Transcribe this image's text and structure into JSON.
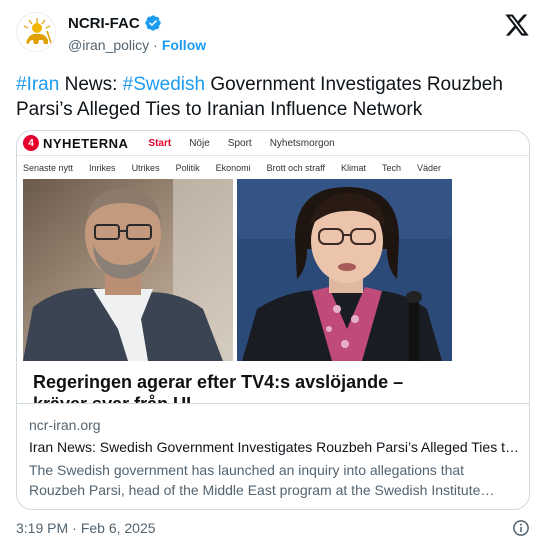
{
  "author": {
    "name": "NCRI-FAC",
    "handle": "@iran_policy",
    "separator": "·",
    "follow_label": "Follow",
    "avatar_icon": "lion-and-sun-emblem-icon",
    "verified_icon": "verified-badge-icon"
  },
  "platform_icon": "x-logo-icon",
  "tweet": {
    "hashtag1": "#Iran",
    "text1": " News: ",
    "hashtag2": "#Swedish",
    "text2": " Government Investigates Rouzbeh Parsi’s Alleged Ties to Iranian Influence Network"
  },
  "card_image": {
    "site_logo": "4",
    "site_name": "NYHETERNA",
    "top_nav": [
      "Start",
      "Nöje",
      "Sport",
      "Nyhetsmorgon"
    ],
    "active_nav": "Start",
    "sub_nav": [
      "Senaste nytt",
      "Inrikes",
      "Utrikes",
      "Politik",
      "Ekonomi",
      "Brott och straff",
      "Klimat",
      "Tech",
      "Väder"
    ],
    "headline_line1": "Regeringen agerar efter TV4:s avslöjande –",
    "headline_line2": "kräver svar från UI"
  },
  "card": {
    "domain": "ncr-iran.org",
    "title": "Iran News: Swedish Government Investigates Rouzbeh Parsi’s Alleged Ties to Iranian Influence Network",
    "description": "The Swedish government has launched an inquiry into allegations that Rouzbeh Parsi, head of the Middle East program at the Swedish Institute…"
  },
  "footer": {
    "time": "3:19 PM",
    "separator": "·",
    "date": "Feb 6, 2025",
    "info_icon": "info-icon"
  },
  "colors": {
    "link": "#1d9bf0",
    "text": "#0f1419",
    "secondary": "#536471",
    "tv4_red": "#e4002b"
  }
}
